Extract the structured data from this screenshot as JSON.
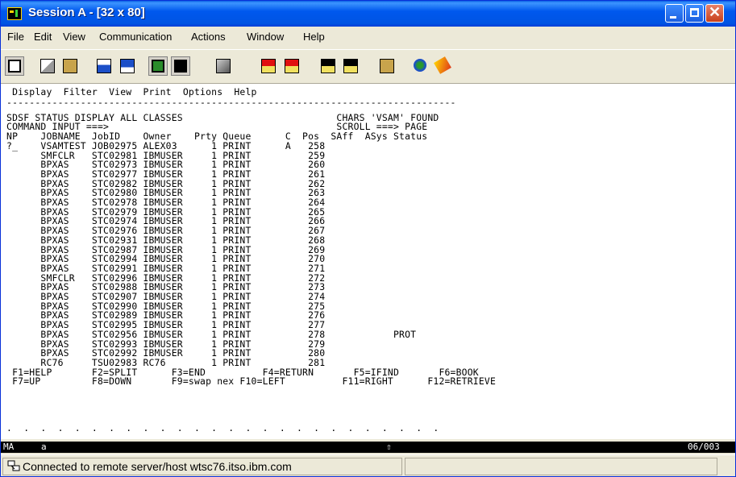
{
  "window": {
    "title": "Session A - [32 x 80]"
  },
  "menu": [
    "File",
    "Edit",
    "View",
    "Communication",
    "Actions",
    "Window",
    "Help"
  ],
  "toolbar_icons": [
    "print-screen-icon",
    "copy-icon",
    "paste-icon",
    "send-icon",
    "receive-icon",
    "display-icon",
    "keypad-icon",
    "macro-icon",
    "record-macro-icon",
    "stop-macro-icon",
    "play-macro-icon",
    "play-macro-2-icon",
    "clipboard-icon",
    "web-icon",
    "help-icon"
  ],
  "terminal": {
    "lines": [
      "  Display  Filter  View  Print  Options  Help",
      " -------------------------------------------------------------------------------",
      " SDSF STATUS DISPLAY ALL CLASSES                           CHARS 'VSAM' FOUND",
      " COMMAND INPUT ===>                                        SCROLL ===> PAGE",
      " NP    JOBNAME  JobID    Owner    Prty Queue      C  Pos  SAff  ASys Status",
      " ?_    VSAMTEST JOB02975 ALEX03      1 PRINT      A   258",
      "       SMFCLR   STC02981 IBMUSER     1 PRINT          259",
      "       BPXAS    STC02973 IBMUSER     1 PRINT          260",
      "       BPXAS    STC02977 IBMUSER     1 PRINT          261",
      "       BPXAS    STC02982 IBMUSER     1 PRINT          262",
      "       BPXAS    STC02980 IBMUSER     1 PRINT          263",
      "       BPXAS    STC02978 IBMUSER     1 PRINT          264",
      "       BPXAS    STC02979 IBMUSER     1 PRINT          265",
      "       BPXAS    STC02974 IBMUSER     1 PRINT          266",
      "       BPXAS    STC02976 IBMUSER     1 PRINT          267",
      "       BPXAS    STC02931 IBMUSER     1 PRINT          268",
      "       BPXAS    STC02987 IBMUSER     1 PRINT          269",
      "       BPXAS    STC02994 IBMUSER     1 PRINT          270",
      "       BPXAS    STC02991 IBMUSER     1 PRINT          271",
      "       SMFCLR   STC02996 IBMUSER     1 PRINT          272",
      "       BPXAS    STC02988 IBMUSER     1 PRINT          273",
      "       BPXAS    STC02907 IBMUSER     1 PRINT          274",
      "       BPXAS    STC02990 IBMUSER     1 PRINT          275",
      "       BPXAS    STC02989 IBMUSER     1 PRINT          276",
      "       BPXAS    STC02995 IBMUSER     1 PRINT          277",
      "       BPXAS    STC02956 IBMUSER     1 PRINT          278            PROT",
      "       BPXAS    STC02993 IBMUSER     1 PRINT          279",
      "       BPXAS    STC02992 IBMUSER     1 PRINT          280",
      "       RC76     TSU02983 RC76        1 PRINT          281",
      "  F1=HELP       F2=SPLIT      F3=END          F4=RETURN       F5=IFIND       F6=BOOK",
      "  F7=UP         F8=DOWN       F9=swap nex F10=LEFT          F11=RIGHT      F12=RETRIEVE",
      " .  .  .  .  .  .  .  .  .  .  .  .  .  .  .  .  .  .  .  .  .  .  .  .  .  ."
    ]
  },
  "oia": {
    "left": "MA",
    "mid": "a",
    "arrow": "⇧",
    "pos": "06/003"
  },
  "status": {
    "text": "Connected to remote server/host wtsc76.itso.ibm.com"
  }
}
